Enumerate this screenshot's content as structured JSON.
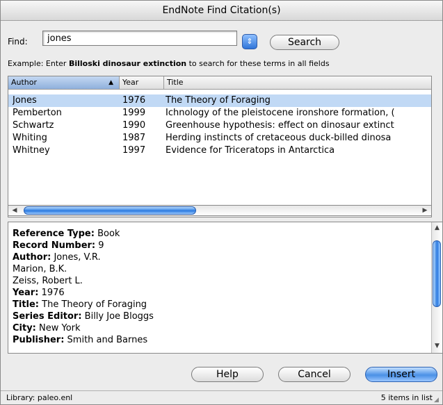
{
  "window": {
    "title": "EndNote Find Citation(s)"
  },
  "find": {
    "label": "Find:",
    "value": "jones",
    "stepper_icon": "⇕",
    "search_label": "Search",
    "example_prefix": "Example: Enter ",
    "example_bold": "Billoski dinosaur extinction",
    "example_suffix": " to search for these terms in all fields"
  },
  "table": {
    "columns": {
      "author": "Author",
      "year": "Year",
      "title": "Title"
    },
    "sort_indicator": "▲",
    "rows": [
      {
        "author": "Jones",
        "year": "1976",
        "title": "The Theory of Foraging"
      },
      {
        "author": "Pemberton",
        "year": "1999",
        "title": "Ichnology of the pleistocene ironshore formation, ("
      },
      {
        "author": "Schwartz",
        "year": "1990",
        "title": "Greenhouse hypothesis: effect on dinosaur extinct"
      },
      {
        "author": "Whiting",
        "year": "1987",
        "title": "Herding instincts of cretaceous duck-billed dinosa"
      },
      {
        "author": "Whitney",
        "year": "1997",
        "title": "Evidence for Triceratops in Antarctica"
      }
    ],
    "selected_index": 0
  },
  "details": {
    "lines": [
      {
        "label": "Reference Type:",
        "value": " Book"
      },
      {
        "label": "Record Number:",
        "value": " 9"
      },
      {
        "label": "Author:",
        "value": " Jones, V.R."
      },
      {
        "label": "",
        "value": "Marion, B.K."
      },
      {
        "label": "",
        "value": "Zeiss, Robert L."
      },
      {
        "label": "Year:",
        "value": " 1976"
      },
      {
        "label": "Title:",
        "value": " The Theory of Foraging"
      },
      {
        "label": "Series Editor:",
        "value": " Billy Joe Bloggs"
      },
      {
        "label": "City:",
        "value": " New York"
      },
      {
        "label": "Publisher:",
        "value": " Smith and Barnes"
      }
    ]
  },
  "buttons": {
    "help": "Help",
    "cancel": "Cancel",
    "insert": "Insert"
  },
  "status": {
    "library": "Library: paleo.enl",
    "count": "5 items in list"
  }
}
